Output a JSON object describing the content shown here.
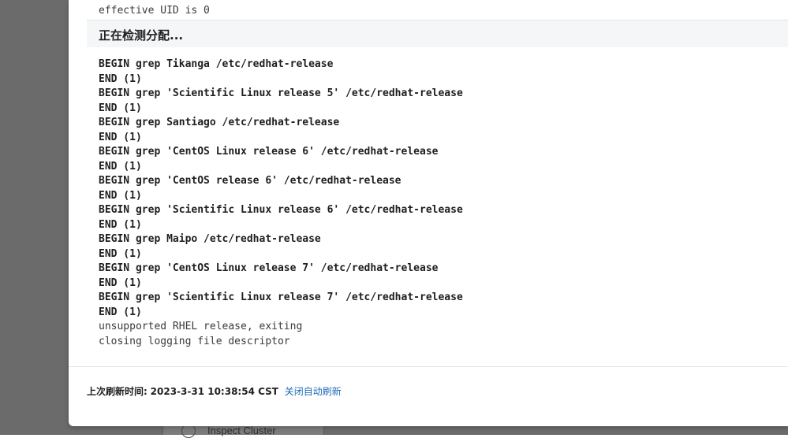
{
  "background_panel": {
    "label": "Inspect Cluster"
  },
  "dialog": {
    "pre_line": "effective UID is 0",
    "section_title": "正在检测分配...",
    "log_lines": [
      {
        "text": "BEGIN grep Tikanga /etc/redhat-release",
        "style": "bold"
      },
      {
        "text": "END (1)",
        "style": "bold"
      },
      {
        "text": "BEGIN grep 'Scientific Linux release 5' /etc/redhat-release",
        "style": "bold"
      },
      {
        "text": "END (1)",
        "style": "bold"
      },
      {
        "text": "BEGIN grep Santiago /etc/redhat-release",
        "style": "bold"
      },
      {
        "text": "END (1)",
        "style": "bold"
      },
      {
        "text": "BEGIN grep 'CentOS Linux release 6' /etc/redhat-release",
        "style": "bold"
      },
      {
        "text": "END (1)",
        "style": "bold"
      },
      {
        "text": "BEGIN grep 'CentOS release 6' /etc/redhat-release",
        "style": "bold"
      },
      {
        "text": "END (1)",
        "style": "bold"
      },
      {
        "text": "BEGIN grep 'Scientific Linux release 6' /etc/redhat-release",
        "style": "bold"
      },
      {
        "text": "END (1)",
        "style": "bold"
      },
      {
        "text": "BEGIN grep Maipo /etc/redhat-release",
        "style": "bold"
      },
      {
        "text": "END (1)",
        "style": "bold"
      },
      {
        "text": "BEGIN grep 'CentOS Linux release 7' /etc/redhat-release",
        "style": "bold"
      },
      {
        "text": "END (1)",
        "style": "bold"
      },
      {
        "text": "BEGIN grep 'Scientific Linux release 7' /etc/redhat-release",
        "style": "bold"
      },
      {
        "text": "END (1)",
        "style": "bold"
      },
      {
        "text": "unsupported RHEL release, exiting",
        "style": "normal"
      },
      {
        "text": "closing logging file descriptor",
        "style": "normal"
      }
    ],
    "footer": {
      "refresh_label": "上次刷新时间:",
      "refresh_time": "2023-3-31 10:38:54 CST",
      "toggle_link": "关闭自动刷新"
    }
  },
  "colors": {
    "backdrop": "#6b6b6b",
    "link": "#1e6bb8",
    "header_bg": "#f5f6f7"
  }
}
